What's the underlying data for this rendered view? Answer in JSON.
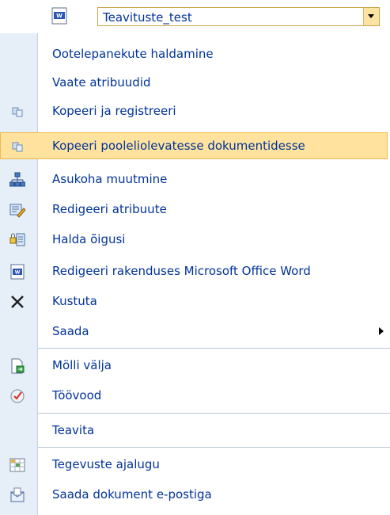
{
  "title": {
    "doc_icon": "word-document-icon",
    "value": "Teavituste_test"
  },
  "menu": {
    "items": [
      {
        "label": "Ootelepanekute haldamine",
        "icon": ""
      },
      {
        "label": "Vaate atribuudid",
        "icon": ""
      },
      {
        "label": "Kopeeri ja registreeri",
        "icon": "copy-icon"
      },
      {
        "label": "Kopeeri pooleliolevatesse dokumentidesse",
        "icon": "copy-icon",
        "highlighted": true
      },
      {
        "label": "Asukoha muutmine",
        "icon": "sitemap-icon"
      },
      {
        "label": "Redigeeri atribuute",
        "icon": "edit-properties-icon"
      },
      {
        "label": "Halda õigusi",
        "icon": "permissions-icon"
      },
      {
        "label": "Redigeeri rakenduses Microsoft Office Word",
        "icon": "word-document-icon"
      },
      {
        "label": "Kustuta",
        "icon": "delete-x-icon"
      },
      {
        "label": "Saada",
        "icon": "",
        "submenu": true
      },
      {
        "label": "Mölli välja",
        "icon": "checkout-icon"
      },
      {
        "label": "Töövood",
        "icon": "workflow-icon"
      },
      {
        "label": "Teavita",
        "icon": ""
      },
      {
        "label": "Tegevuste ajalugu",
        "icon": "history-icon"
      },
      {
        "label": "Saada dokument e-postiga",
        "icon": "email-document-icon"
      }
    ]
  },
  "colors": {
    "text": "#003399",
    "gutter": "#e6eef7",
    "highlight": "#ffe29e",
    "highlight_border": "#f0b94a"
  }
}
